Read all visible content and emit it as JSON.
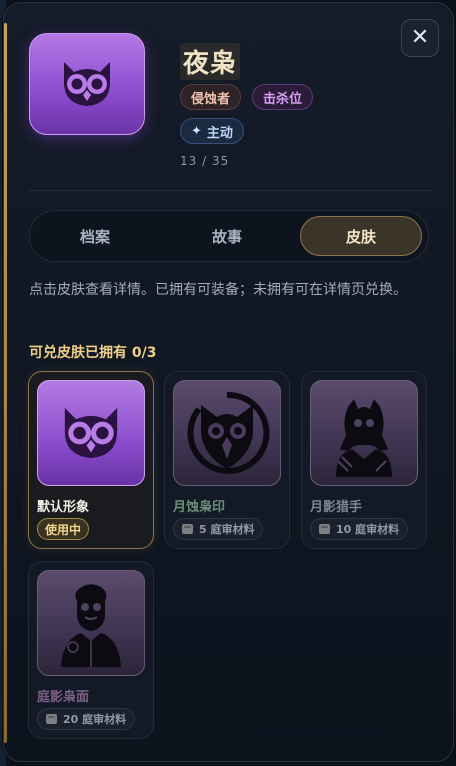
{
  "hero": {
    "name": "夜枭",
    "class_tag": "侵蚀者",
    "role_tag": "击杀位",
    "main_tag": "主动",
    "progress": "13 / 35",
    "avatar_icon": "owl-icon"
  },
  "tabs": [
    {
      "label": "档案",
      "active": false
    },
    {
      "label": "故事",
      "active": false
    },
    {
      "label": "皮肤",
      "active": true
    }
  ],
  "skins_section": {
    "hint": "点击皮肤查看详情。已拥有可装备；未拥有可在详情页兑换。",
    "redeem_count": "可兑皮肤已拥有 0/3"
  },
  "skins": [
    {
      "name": "默认形象",
      "owned": true,
      "status": "使用中",
      "icon": "owl-icon"
    },
    {
      "name": "月蚀枭印",
      "owned": false,
      "cost": "5 庭审材料",
      "icon": "eclipse-owl-icon"
    },
    {
      "name": "月影猎手",
      "owned": false,
      "cost": "10 庭审材料",
      "icon": "hooded-hunter-icon"
    },
    {
      "name": "庭影枭面",
      "owned": false,
      "cost": "20 庭审材料",
      "icon": "masked-figure-icon"
    }
  ],
  "colors": {
    "accent_gold": "#f0cf86",
    "owl_purple": "#8e4fd0",
    "panel_bg": "#111824"
  }
}
